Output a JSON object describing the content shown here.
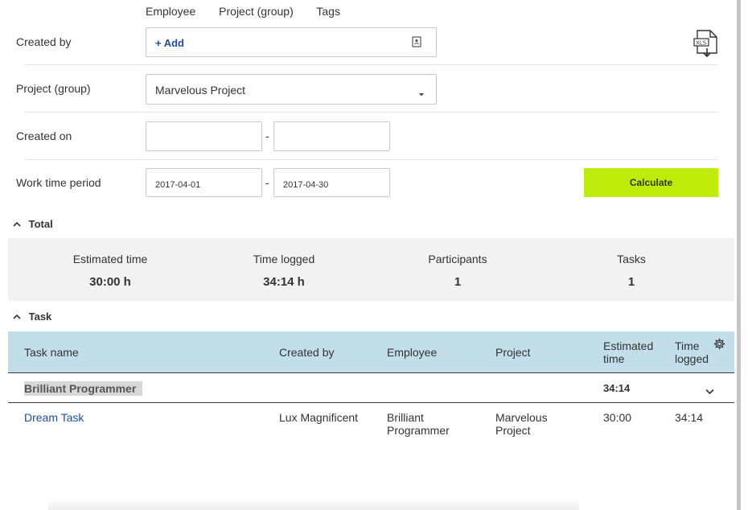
{
  "top_tabs": [
    "Employee",
    "Project (group)",
    "Tags"
  ],
  "filters": {
    "created_by": {
      "label": "Created by",
      "add_label": "+ Add"
    },
    "project": {
      "label": "Project (group)",
      "value": "Marvelous Project"
    },
    "created_on": {
      "label": "Created on",
      "from": "",
      "to": "",
      "separator": "-"
    },
    "work_time": {
      "label": "Work time period",
      "from": "2017-04-01",
      "to": "2017-04-30",
      "separator": "-"
    },
    "calculate_label": "Calculate"
  },
  "export_icon": "xls-download-icon",
  "total": {
    "title": "Total",
    "estimated_label": "Estimated time",
    "estimated_value": "30:00 h",
    "logged_label": "Time logged",
    "logged_value": "34:14 h",
    "participants_label": "Participants",
    "participants_value": "1",
    "tasks_label": "Tasks",
    "tasks_value": "1"
  },
  "task": {
    "title": "Task",
    "columns": {
      "name": "Task name",
      "created_by": "Created by",
      "employee": "Employee",
      "project": "Project",
      "estimated": "Estimated time",
      "logged": "Time logged"
    },
    "group": {
      "name": "Brilliant Programmer",
      "time": "34:14"
    },
    "rows": [
      {
        "name": "Dream Task",
        "created_by": "Lux Magnificent",
        "employee": "Brilliant Programmer",
        "project": "Marvelous Project",
        "estimated": "30:00",
        "logged": "34:14"
      }
    ]
  },
  "colors": {
    "accent": "#bfec0a",
    "table_header": "#c2dee9",
    "link": "#1f4d9c"
  }
}
